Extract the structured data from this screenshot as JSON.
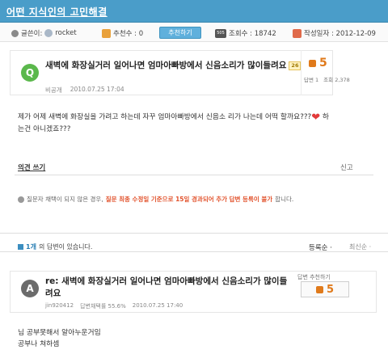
{
  "header": {
    "title": "어떤 지식인의 고민해결"
  },
  "meta": {
    "author_label": "글쓴이:",
    "author_name": "rocket",
    "recommend_label": "추천수 : 0",
    "recommend_button": "추천하기",
    "views_label": "조회수 : 18742",
    "date_label": "작성일자 : 2012-12-09"
  },
  "question": {
    "badge": "Q",
    "title": "새벽에 화장실거러 일어나면 엄마아빠방에서 신음소리가 많이들려요",
    "tag": "26",
    "author": "비공개",
    "date": "2010.07.25 17:04",
    "votes": "5",
    "answers_count": "답변 1",
    "views_count": "조회 2,378",
    "body_line1": "제가 어제 새벽에 화장실을 가려고 하는데 자꾸 엄마아빠방에서 신음소 리가 나는데 어떡 할까요???",
    "body_line1_tail": " 하",
    "body_line2": "는건 아니겠죠???"
  },
  "actions": {
    "opinion": "의견 쓰기",
    "report": "신고"
  },
  "notice": {
    "prefix": "질문자 채택이 되지 않은 경우,",
    "highlight": "질문 최종 수정일 기준으로 15일 경과되어 추가 답변 등록이 불가",
    "suffix": "합니다."
  },
  "answers_header": {
    "count_num": "1개",
    "count_text": "의 답변이 있습니다.",
    "sort_registered": "등록순 ·",
    "sort_latest": "최신순 ·"
  },
  "answer": {
    "badge": "A",
    "title": "re: 새벽에 화장실거러 일어나면 엄마아빠방에서 신음소리가 많이들려요",
    "author": "jin920412",
    "adoption": "답변채택률 55.6%",
    "date": "2010.07.25 17:40",
    "vote_label": "답변 추천하기",
    "votes": "5",
    "body_line1": "님 공부못해서 알아누운거임",
    "body_line2": "공부나 쳐하셈"
  }
}
